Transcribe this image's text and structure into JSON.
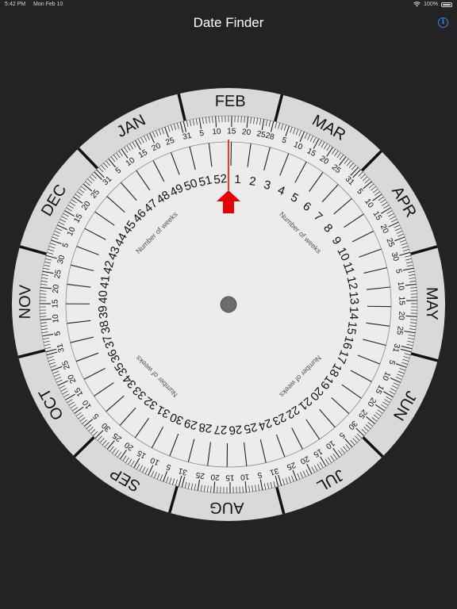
{
  "status_bar": {
    "time": "5:42 PM",
    "date": "Mon Feb 10",
    "battery": "100%"
  },
  "nav": {
    "title": "Date Finder"
  },
  "dial": {
    "months": [
      "JAN",
      "FEB",
      "MAR",
      "APR",
      "MAY",
      "JUN",
      "JUL",
      "AUG",
      "SEP",
      "OCT",
      "NOV",
      "DEC"
    ],
    "month_days": [
      31,
      28,
      31,
      30,
      31,
      30,
      31,
      31,
      30,
      31,
      30,
      31
    ],
    "day_labels": [
      "5",
      "10",
      "15",
      "20",
      "25"
    ],
    "week_numbers": [
      "1",
      "2",
      "3",
      "4",
      "5",
      "6",
      "7",
      "8",
      "9",
      "10",
      "11",
      "12",
      "13",
      "14",
      "15",
      "16",
      "17",
      "18",
      "19",
      "20",
      "21",
      "22",
      "23",
      "24",
      "25",
      "26",
      "27",
      "28",
      "29",
      "30",
      "31",
      "32",
      "33",
      "34",
      "35",
      "36",
      "37",
      "38",
      "39",
      "40",
      "41",
      "42",
      "43",
      "44",
      "45",
      "46",
      "47",
      "48",
      "49",
      "50",
      "51",
      "52"
    ],
    "weeks_label": "Number of weeks",
    "pointer_day_of_year": 46,
    "colors": {
      "outer_ring": "#d9d9d9",
      "inner_disc": "#ececec",
      "pointer": "#e60000",
      "hub": "#6a6a6a",
      "ink": "#111111"
    }
  }
}
